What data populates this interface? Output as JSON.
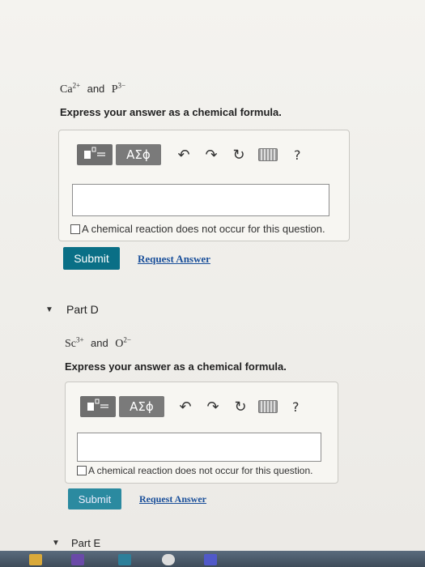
{
  "part_c": {
    "ion1": "Ca",
    "ion1_charge": "2+",
    "joiner": "and",
    "ion2": "P",
    "ion2_charge": "3−",
    "instruction": "Express your answer as a chemical formula.",
    "symbols_label": "ΑΣϕ",
    "help_label": "?",
    "input_value": "",
    "checkbox_label": "A chemical reaction does not occur for this question.",
    "submit_label": "Submit",
    "request_label": "Request Answer"
  },
  "part_d": {
    "title": "Part D",
    "ion1": "Sc",
    "ion1_charge": "3+",
    "joiner": "and",
    "ion2": "O",
    "ion2_charge": "2−",
    "instruction": "Express your answer as a chemical formula.",
    "symbols_label": "ΑΣϕ",
    "help_label": "?",
    "input_value": "",
    "checkbox_label": "A chemical reaction does not occur for this question.",
    "submit_label": "Submit",
    "request_label": "Request Answer"
  },
  "part_e": {
    "title": "Part E"
  },
  "icons": {
    "collapse": "caret-down-icon",
    "undo": "undo-icon",
    "redo": "redo-icon",
    "reset": "reset-icon",
    "keyboard": "keyboard-icon",
    "help": "help-icon",
    "templates": "templates-icon"
  },
  "colors": {
    "submit": "#0a6f86",
    "link": "#1a4f9a",
    "toolbar_button": "#7a7a7a"
  }
}
